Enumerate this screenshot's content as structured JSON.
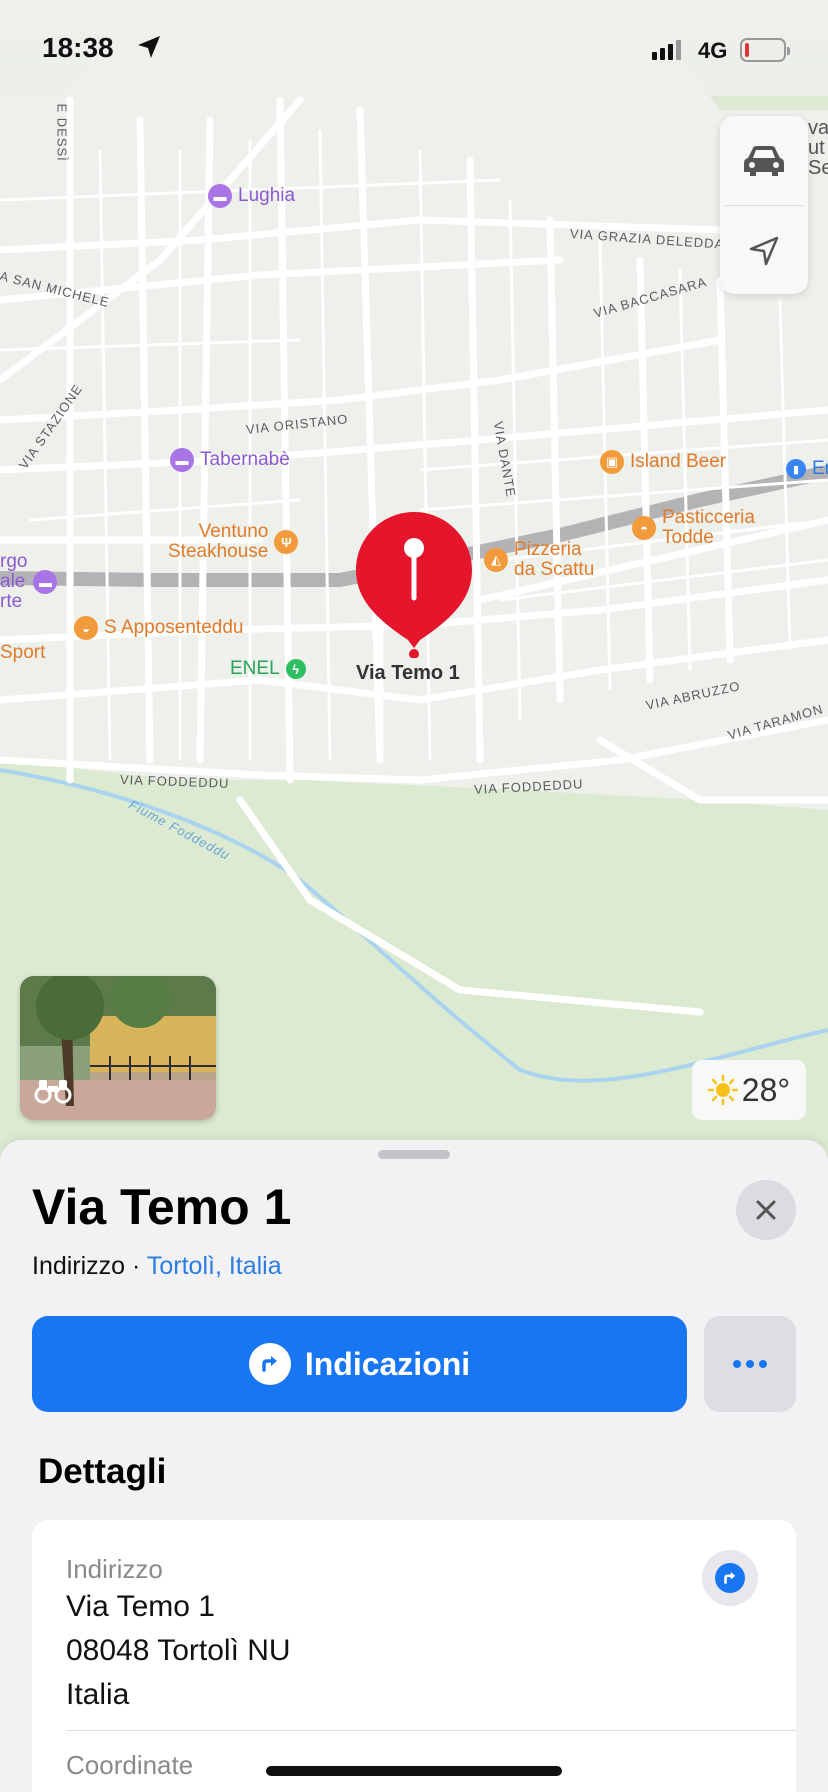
{
  "status_bar": {
    "time": "18:38",
    "network": "4G",
    "battery_level_fraction": 0.1,
    "battery_color": "#e33333"
  },
  "map": {
    "background_color": "#eef0ec",
    "pin_color": "#e5152b",
    "pin_label": "Via Temo 1",
    "pois": {
      "lughia": "Lughia",
      "tabernabe": "Tabernabè",
      "ventuno_line1": "Ventuno",
      "ventuno_line2": "Steakhouse",
      "s_apposenteddu": "S Apposenteddu",
      "enel": "ENEL",
      "island_beer": "Island Beer",
      "pasticceria_line1": "Pasticceria",
      "pasticceria_line2": "Todde",
      "pizzeria_line1": "Pizzeria",
      "pizzeria_line2": "da Scattu",
      "left_partial_1": "rgo",
      "left_partial_2": "ale",
      "left_partial_3": "rte",
      "left_sport": "Sport",
      "right_partial": "Er",
      "top_right_partial_1": "va",
      "top_right_partial_2": "ut",
      "top_right_partial_3": "Se"
    },
    "streets": {
      "e_dessi": "E DESSÌ",
      "grazia_deledda": "VIA GRAZIA DELEDDA",
      "san_michele": "A SAN MICHELE",
      "baccasara": "VIA BACCASARA",
      "stazione": "VIA STAZIONE",
      "oristano": "VIA ORISTANO",
      "dante": "VIA DANTE",
      "abruzzo": "VIA ABRUZZO",
      "taramon": "VIA TARAMON",
      "foddeddu_left": "VIA FODDEDDU",
      "foddeddu_right": "VIA FODDEDDU",
      "fiume": "Fiume Foddeddu"
    },
    "weather_temp": "28°",
    "weather_icon": "sun-icon",
    "controls": [
      "car-icon",
      "location-arrow-icon"
    ],
    "lookaround_icon": "binoculars-icon"
  },
  "sheet": {
    "title": "Via Temo 1",
    "subtitle_type": "Indirizzo",
    "subtitle_separator": " · ",
    "subtitle_link": "Tortolì, Italia",
    "directions_label": "Indicazioni",
    "accent_color": "#1976f3",
    "details_heading": "Dettagli",
    "address_label": "Indirizzo",
    "address_lines": [
      "Via Temo 1",
      "08048 Tortolì NU",
      "Italia"
    ],
    "coordinates_label": "Coordinate"
  }
}
